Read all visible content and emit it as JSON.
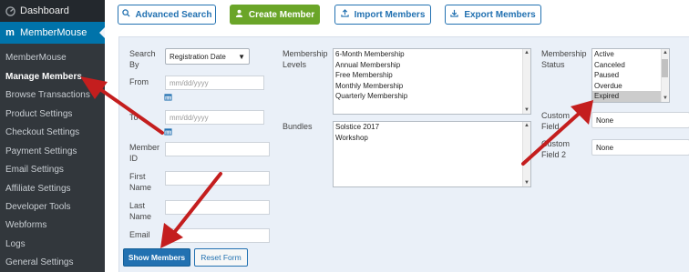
{
  "sidebar": {
    "dashboard": "Dashboard",
    "plugin": "MemberMouse",
    "items": [
      {
        "label": "MemberMouse",
        "active": false
      },
      {
        "label": "Manage Members",
        "active": true
      },
      {
        "label": "Browse Transactions",
        "active": false
      },
      {
        "label": "Product Settings",
        "active": false
      },
      {
        "label": "Checkout Settings",
        "active": false
      },
      {
        "label": "Payment Settings",
        "active": false
      },
      {
        "label": "Email Settings",
        "active": false
      },
      {
        "label": "Affiliate Settings",
        "active": false
      },
      {
        "label": "Developer Tools",
        "active": false
      },
      {
        "label": "Webforms",
        "active": false
      },
      {
        "label": "Logs",
        "active": false
      },
      {
        "label": "General Settings",
        "active": false
      }
    ]
  },
  "toolbar": {
    "advanced_search": "Advanced Search",
    "create_member": "Create Member",
    "import_members": "Import Members",
    "export_members": "Export Members"
  },
  "form": {
    "search_by_label": "Search By",
    "search_by_value": "Registration Date",
    "from_label": "From",
    "to_label": "To",
    "date_placeholder": "mm/dd/yyyy",
    "member_id_label": "Member ID",
    "first_name_label": "First Name",
    "last_name_label": "Last Name",
    "email_label": "Email",
    "membership_levels_label": "Membership Levels",
    "membership_levels": [
      "6-Month Membership",
      "Annual Membership",
      "Free Membership",
      "Monthly Membership",
      "Quarterly Membership"
    ],
    "bundles_label": "Bundles",
    "bundles": [
      "Solstice 2017",
      "Workshop"
    ],
    "membership_status_label": "Membership Status",
    "membership_status": [
      {
        "label": "Active",
        "selected": false
      },
      {
        "label": "Canceled",
        "selected": false
      },
      {
        "label": "Paused",
        "selected": false
      },
      {
        "label": "Overdue",
        "selected": false
      },
      {
        "label": "Expired",
        "selected": true
      }
    ],
    "custom_field_label": "Custom Field",
    "custom_field_value": "None",
    "custom_field_2_label": "Custom Field 2",
    "custom_field_2_value": "None"
  },
  "actions": {
    "show_members": "Show Members",
    "reset_form": "Reset Form"
  },
  "colors": {
    "sidebar_bg": "#23282d",
    "accent": "#0073aa",
    "green": "#6aa528",
    "arrow": "#c41e1e"
  }
}
